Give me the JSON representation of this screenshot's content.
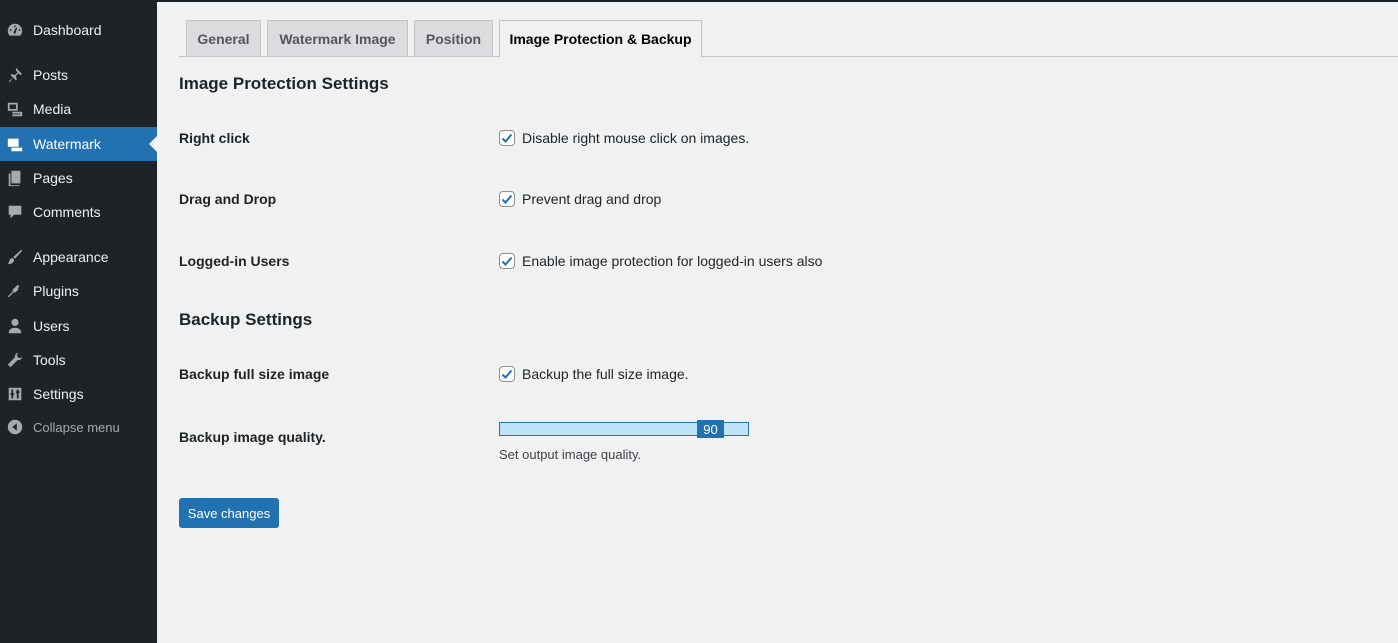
{
  "sidebar": {
    "items": [
      {
        "label": "Dashboard",
        "icon": "dashboard-icon"
      },
      {
        "label": "Posts",
        "icon": "pin-icon"
      },
      {
        "label": "Media",
        "icon": "media-icon"
      },
      {
        "label": "Watermark",
        "icon": "watermark-icon",
        "active": true
      },
      {
        "label": "Pages",
        "icon": "pages-icon"
      },
      {
        "label": "Comments",
        "icon": "comment-icon"
      },
      {
        "label": "Appearance",
        "icon": "brush-icon"
      },
      {
        "label": "Plugins",
        "icon": "plug-icon"
      },
      {
        "label": "Users",
        "icon": "user-icon"
      },
      {
        "label": "Tools",
        "icon": "wrench-icon"
      },
      {
        "label": "Settings",
        "icon": "sliders-icon"
      }
    ],
    "collapse_label": "Collapse menu"
  },
  "tabs": [
    {
      "label": "General"
    },
    {
      "label": "Watermark Image"
    },
    {
      "label": "Position"
    },
    {
      "label": "Image Protection & Backup",
      "active": true
    }
  ],
  "protection": {
    "title": "Image Protection Settings",
    "rows": [
      {
        "label": "Right click",
        "checkbox_label": "Disable right mouse click on images.",
        "checked": true
      },
      {
        "label": "Drag and Drop",
        "checkbox_label": "Prevent drag and drop",
        "checked": true
      },
      {
        "label": "Logged-in Users",
        "checkbox_label": "Enable image protection for logged-in users also",
        "checked": true
      }
    ]
  },
  "backup": {
    "title": "Backup Settings",
    "full_size": {
      "label": "Backup full size image",
      "checkbox_label": "Backup the full size image.",
      "checked": true
    },
    "quality": {
      "label": "Backup image quality.",
      "value": "90",
      "min": 0,
      "max": 100,
      "help": "Set output image quality."
    }
  },
  "save_label": "Save changes",
  "colors": {
    "accent": "#2271b1",
    "sidebar_bg": "#1d2327",
    "page_bg": "#f1f1f1"
  }
}
